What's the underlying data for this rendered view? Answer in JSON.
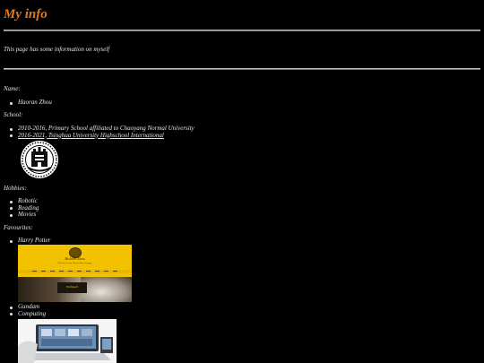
{
  "page": {
    "title": "My info",
    "intro": "This page has some information on myself"
  },
  "name": {
    "label": "Name:",
    "items": [
      "Haoran Zhou"
    ]
  },
  "school": {
    "label": "School:",
    "items": [
      {
        "text": "2010-2016, Primary School affiliated to Chaoyang Normal University",
        "link": false
      },
      {
        "text": "2016-2021, Tsinghua University Highschool International",
        "link": true
      }
    ],
    "crest_icon": "school-crest-logo"
  },
  "hobbies": {
    "label": "Hobbies:",
    "items": [
      "Robotic",
      "Reading",
      "Movies"
    ]
  },
  "favourites": {
    "label": "Favourites:",
    "items": [
      "Harry Potter",
      "Gundam",
      "Computing"
    ],
    "harry_potter_thumb": {
      "site_title": "Richard Zhou",
      "tagline": "Welcome to my Harry Potter fan page",
      "card_text": "Hufflepuff"
    }
  },
  "colors": {
    "background": "#000000",
    "title": "#e07b1c",
    "text": "#e6e6e6"
  }
}
